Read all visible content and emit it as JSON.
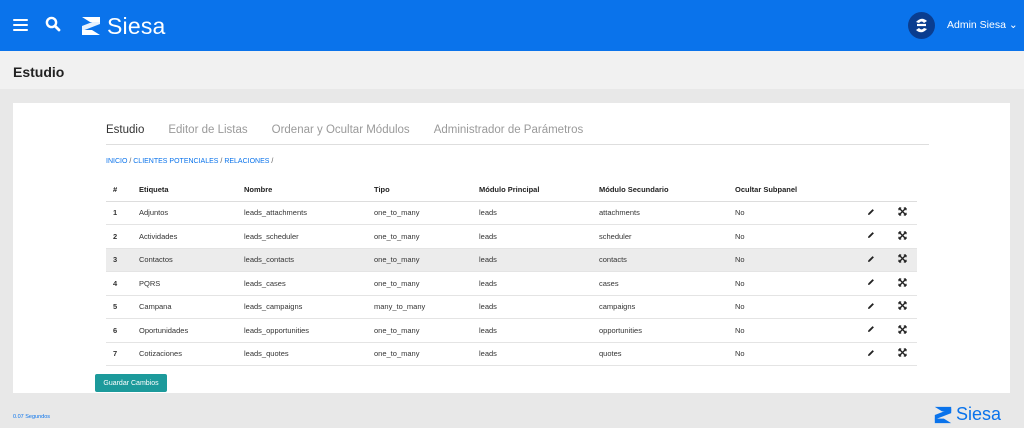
{
  "header": {
    "brand": "Siesa",
    "user": "Admin Siesa ⌄"
  },
  "page": {
    "title": "Estudio"
  },
  "tabs": [
    "Estudio",
    "Editor de Listas",
    "Ordenar y Ocultar Módulos",
    "Administrador de Parámetros"
  ],
  "breadcrumb": {
    "items": [
      "INICIO",
      "CLIENTES POTENCIALES",
      "RELACIONES"
    ],
    "sep": "/"
  },
  "table": {
    "columns": [
      "#",
      "Etiqueta",
      "Nombre",
      "Tipo",
      "Módulo Principal",
      "Módulo Secundario",
      "Ocultar Subpanel"
    ],
    "rows": [
      [
        "1",
        "Adjuntos",
        "leads_attachments",
        "one_to_many",
        "leads",
        "attachments",
        "No"
      ],
      [
        "2",
        "Actividades",
        "leads_scheduler",
        "one_to_many",
        "leads",
        "scheduler",
        "No"
      ],
      [
        "3",
        "Contactos",
        "leads_contacts",
        "one_to_many",
        "leads",
        "contacts",
        "No"
      ],
      [
        "4",
        "PQRS",
        "leads_cases",
        "one_to_many",
        "leads",
        "cases",
        "No"
      ],
      [
        "5",
        "Campana",
        "leads_campaigns",
        "many_to_many",
        "leads",
        "campaigns",
        "No"
      ],
      [
        "6",
        "Oportunidades",
        "leads_opportunities",
        "one_to_many",
        "leads",
        "opportunities",
        "No"
      ],
      [
        "7",
        "Cotizaciones",
        "leads_quotes",
        "one_to_many",
        "leads",
        "quotes",
        "No"
      ]
    ],
    "highlighted_row": 2
  },
  "save_button": "Guardar Cambios",
  "footer": {
    "time": "0.07 Segundos",
    "brand": "Siesa"
  },
  "colors": {
    "primary": "#0a73eb",
    "button": "#1c9a9b"
  }
}
